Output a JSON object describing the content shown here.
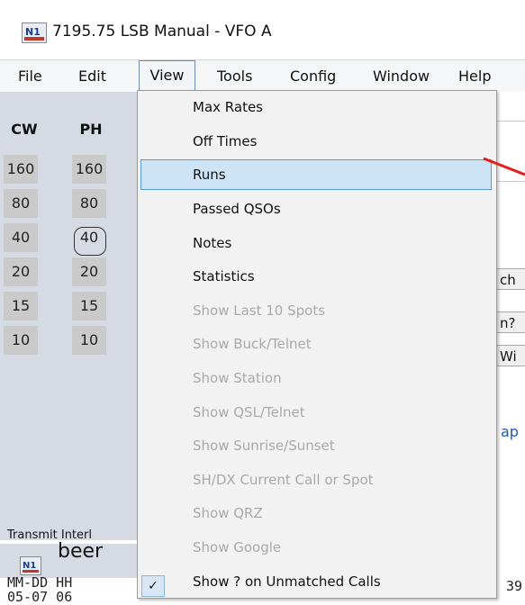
{
  "window": {
    "title": "7195.75 LSB Manual - VFO A"
  },
  "menubar": [
    {
      "label": "File"
    },
    {
      "label": "Edit"
    },
    {
      "label": "View"
    },
    {
      "label": "Tools"
    },
    {
      "label": "Config"
    },
    {
      "label": "Window"
    },
    {
      "label": "Help"
    }
  ],
  "bands": {
    "headers": [
      "CW",
      "PH"
    ],
    "cw": [
      "160",
      "80",
      "40",
      "20",
      "15",
      "10"
    ],
    "ph": [
      "160",
      "80",
      "40",
      "20",
      "15",
      "10"
    ]
  },
  "transmit_label": "Transmit Interl",
  "entry": {
    "callsign": "beer"
  },
  "log": {
    "header": "MM-DD HH",
    "row": "05-07 06"
  },
  "right_panel": {
    "btn1": "ch",
    "btn2": "n?",
    "btn3": "Wi",
    "link": "ap",
    "row_tail": "39"
  },
  "view_menu": {
    "items": [
      {
        "label": "Max Rates",
        "enabled": true
      },
      {
        "label": "Off Times",
        "enabled": true
      },
      {
        "label": "Runs",
        "enabled": true,
        "highlighted": true
      },
      {
        "label": "Passed QSOs",
        "enabled": true
      },
      {
        "label": "Notes",
        "enabled": true
      },
      {
        "label": "Statistics",
        "enabled": true
      },
      {
        "label": "Show Last 10 Spots",
        "enabled": false
      },
      {
        "label": "Show Buck/Telnet",
        "enabled": false
      },
      {
        "label": "Show Station",
        "enabled": false
      },
      {
        "label": "Show QSL/Telnet",
        "enabled": false
      },
      {
        "label": "Show Sunrise/Sunset",
        "enabled": false
      },
      {
        "label": "SH/DX Current Call or Spot",
        "enabled": false
      },
      {
        "label": "Show QRZ",
        "enabled": false
      },
      {
        "label": "Show Google",
        "enabled": false
      },
      {
        "label": "Show ? on Unmatched Calls",
        "enabled": true,
        "checked": true
      }
    ],
    "check_mark": "✓"
  },
  "colors": {
    "highlight": "#cde4f7",
    "highlight_border": "#5b9bd5",
    "arrow": "#e0201b",
    "disabled_text": "#a9a9a9"
  }
}
